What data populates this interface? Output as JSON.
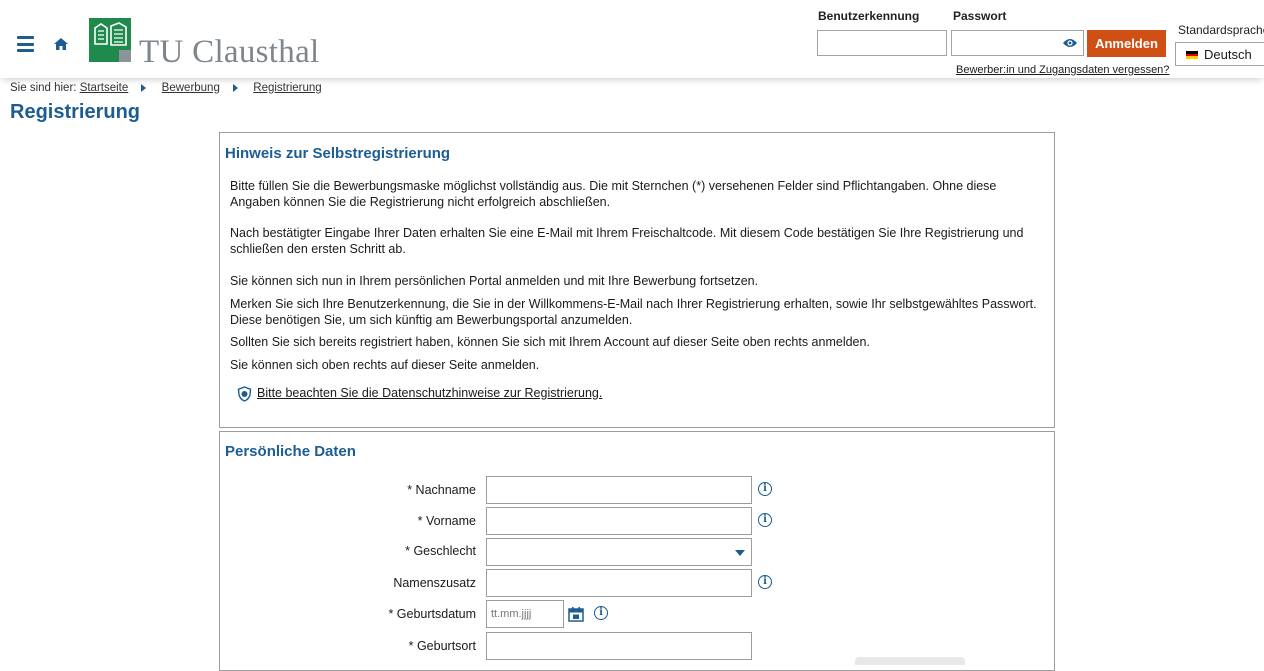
{
  "header": {
    "logo_text": "TU Clausthal",
    "login": {
      "username_label": "Benutzerkennung",
      "password_label": "Passwort",
      "username_value": "",
      "password_value": "",
      "login_button": "Anmelden",
      "forgot_link": "Bewerber:in und Zugangsdaten vergessen?"
    },
    "language": {
      "label": "Standardsprache",
      "selected": "Deutsch"
    }
  },
  "breadcrumb": {
    "prefix": "Sie sind hier:",
    "items": [
      "Startseite",
      "Bewerbung",
      "Registrierung"
    ]
  },
  "page_title": "Registrierung",
  "info_box": {
    "title": "Hinweis zur Selbstregistrierung",
    "paragraphs": [
      "Bitte füllen Sie die Bewerbungsmaske möglichst vollständig aus. Die mit Sternchen (*) versehenen Felder sind Pflichtangaben. Ohne diese Angaben können Sie die Registrierung nicht erfolgreich abschließen.",
      "Nach bestätigter Eingabe Ihrer Daten erhalten Sie eine E-Mail mit Ihrem Freischaltcode. Mit diesem Code bestätigen Sie Ihre Registrierung und schließen den ersten Schritt ab.",
      "Sie können sich nun in Ihrem persönlichen Portal anmelden und mit Ihre Bewerbung fortsetzen.",
      "Merken Sie sich Ihre Benutzerkennung, die Sie in der Willkommens-E-Mail nach Ihrer Registrierung erhalten, sowie Ihr selbstgewähltes Passwort. Diese benötigen Sie, um sich künftig am Bewerbungsportal anzumelden.",
      "Sollten Sie sich bereits registriert haben, können Sie sich mit Ihrem Account auf dieser Seite oben rechts anmelden.",
      "Sie können sich oben rechts auf dieser Seite anmelden."
    ],
    "privacy_link": "Bitte beachten Sie die Datenschutzhinweise zur Registrierung."
  },
  "personal": {
    "title": "Persönliche Daten",
    "fields": {
      "nachname": "* Nachname",
      "vorname": "* Vorname",
      "geschlecht": "* Geschlecht",
      "namenszusatz": "Namenszusatz",
      "geburtsdatum": "* Geburtsdatum",
      "geburtsort": "* Geburtsort"
    },
    "date_placeholder": "tt.mm.jjjj",
    "info_glyph": "i"
  },
  "colors": {
    "accent": "#1d5d92",
    "button": "#cf4f15",
    "logo_green": "#1f8a4c"
  }
}
